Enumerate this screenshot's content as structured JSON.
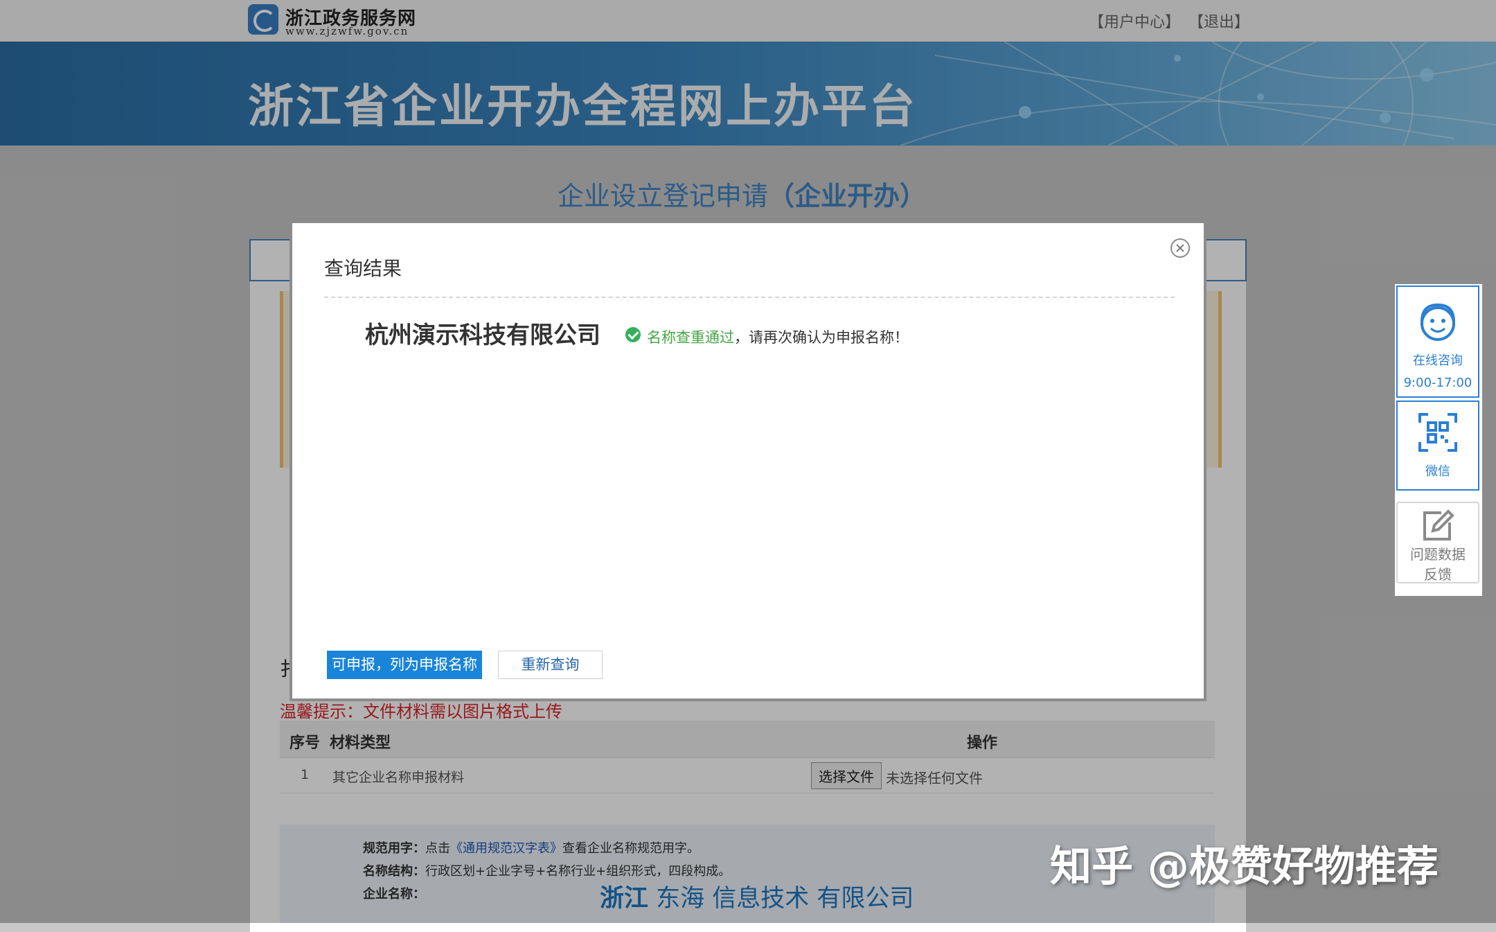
{
  "header": {
    "logo_title": "浙江政务服务网",
    "logo_url": "www.zjzwfw.gov.cn",
    "user_center": "【用户中心】",
    "logout": "【退出】"
  },
  "banner": {
    "title": "浙江省企业开办全程网上办平台"
  },
  "page": {
    "heading_main": "企业设立登记申请",
    "heading_paren": "（企业开办）"
  },
  "upload": {
    "heading": "扌",
    "tip": "温馨提示：文件材料需以图片格式上传",
    "columns": [
      "序号",
      "材料类型",
      "操作"
    ],
    "rows": [
      {
        "index": "1",
        "type": "其它企业名称申报材料",
        "button": "选择文件",
        "status": "未选择任何文件"
      }
    ]
  },
  "guide": {
    "line1_label": "规范用字：",
    "line1_pre": "点击",
    "line1_link": "《通用规范汉字表》",
    "line1_post": "查看企业名称规范用字。",
    "line2_label": "名称结构：",
    "line2_text": "行政区划+企业字号+名称行业+组织形式，四段构成。",
    "line3_label": "企业名称：",
    "sample_region": "浙江",
    "sample_rest": " 东海 信息技术 有限公司"
  },
  "modal": {
    "title": "查询结果",
    "company_name": "杭州演示科技有限公司",
    "result_ok": "名称查重通过",
    "result_rest": "，请再次确认为申报名称！",
    "btn_declare": "可申报，列为申报名称",
    "btn_requery": "重新查询"
  },
  "sidebar": {
    "chat_label": "在线咨询",
    "chat_hours": "9:00-17:00",
    "wechat_label": "微信",
    "feedback_line1": "问题数据",
    "feedback_line2": "反馈"
  },
  "watermark": "知乎 @极赞好物推荐",
  "colors": {
    "accent": "#1a84d8",
    "success": "#32b15a",
    "heading": "#3f83c2",
    "tip_red": "#d9252a"
  },
  "icons": {
    "close": "close-icon",
    "check": "check-circle-icon",
    "chat": "headset-smile-icon",
    "wechat": "qr-code-icon",
    "feedback": "edit-icon"
  }
}
